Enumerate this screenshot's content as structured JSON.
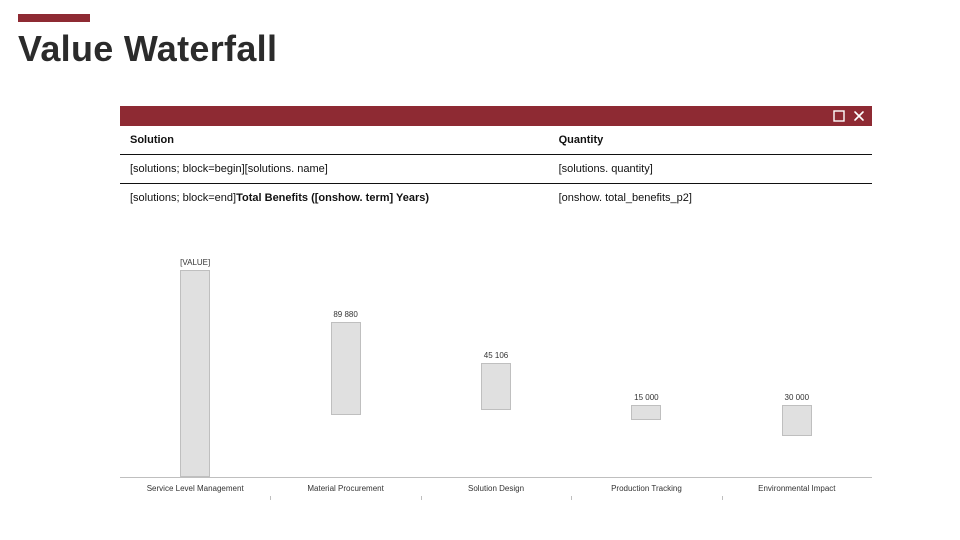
{
  "title": "Value Waterfall",
  "table": {
    "headers": {
      "solution": "Solution",
      "quantity": "Quantity"
    },
    "row": {
      "name": "[solutions; block=begin][solutions. name]",
      "quantity": "[solutions. quantity]"
    },
    "footer": {
      "prefix": "[solutions; block=end]",
      "label": "Total Benefits ([onshow. term] Years)",
      "value": "[onshow. total_benefits_p2]"
    }
  },
  "chart_data": {
    "type": "bar",
    "title": "",
    "xlabel": "",
    "ylabel": "",
    "ylim": [
      0,
      200
    ],
    "baseline": 200,
    "note": "Waterfall; bars hang downward from a baseline of 200. 'offset' is distance from top edge to top of bar; 'value' is bar height. First category's numeric value is hidden behind the placeholder label [VALUE].",
    "categories": [
      "Service Level Management",
      "Material Procurement",
      "Solution Design",
      "Production Tracking",
      "Environmental Impact"
    ],
    "series": [
      {
        "name": "waterfall",
        "label_key": "display",
        "points": [
          {
            "offset": 0,
            "value": 200,
            "display": "[VALUE]"
          },
          {
            "offset": 50,
            "value": 90,
            "display": "89 880"
          },
          {
            "offset": 90,
            "value": 45,
            "display": "45 106"
          },
          {
            "offset": 130,
            "value": 15,
            "display": "15 000"
          },
          {
            "offset": 130,
            "value": 30,
            "display": "30 000"
          }
        ]
      }
    ]
  },
  "icons": {
    "fullscreen": "fullscreen",
    "close": "close"
  }
}
